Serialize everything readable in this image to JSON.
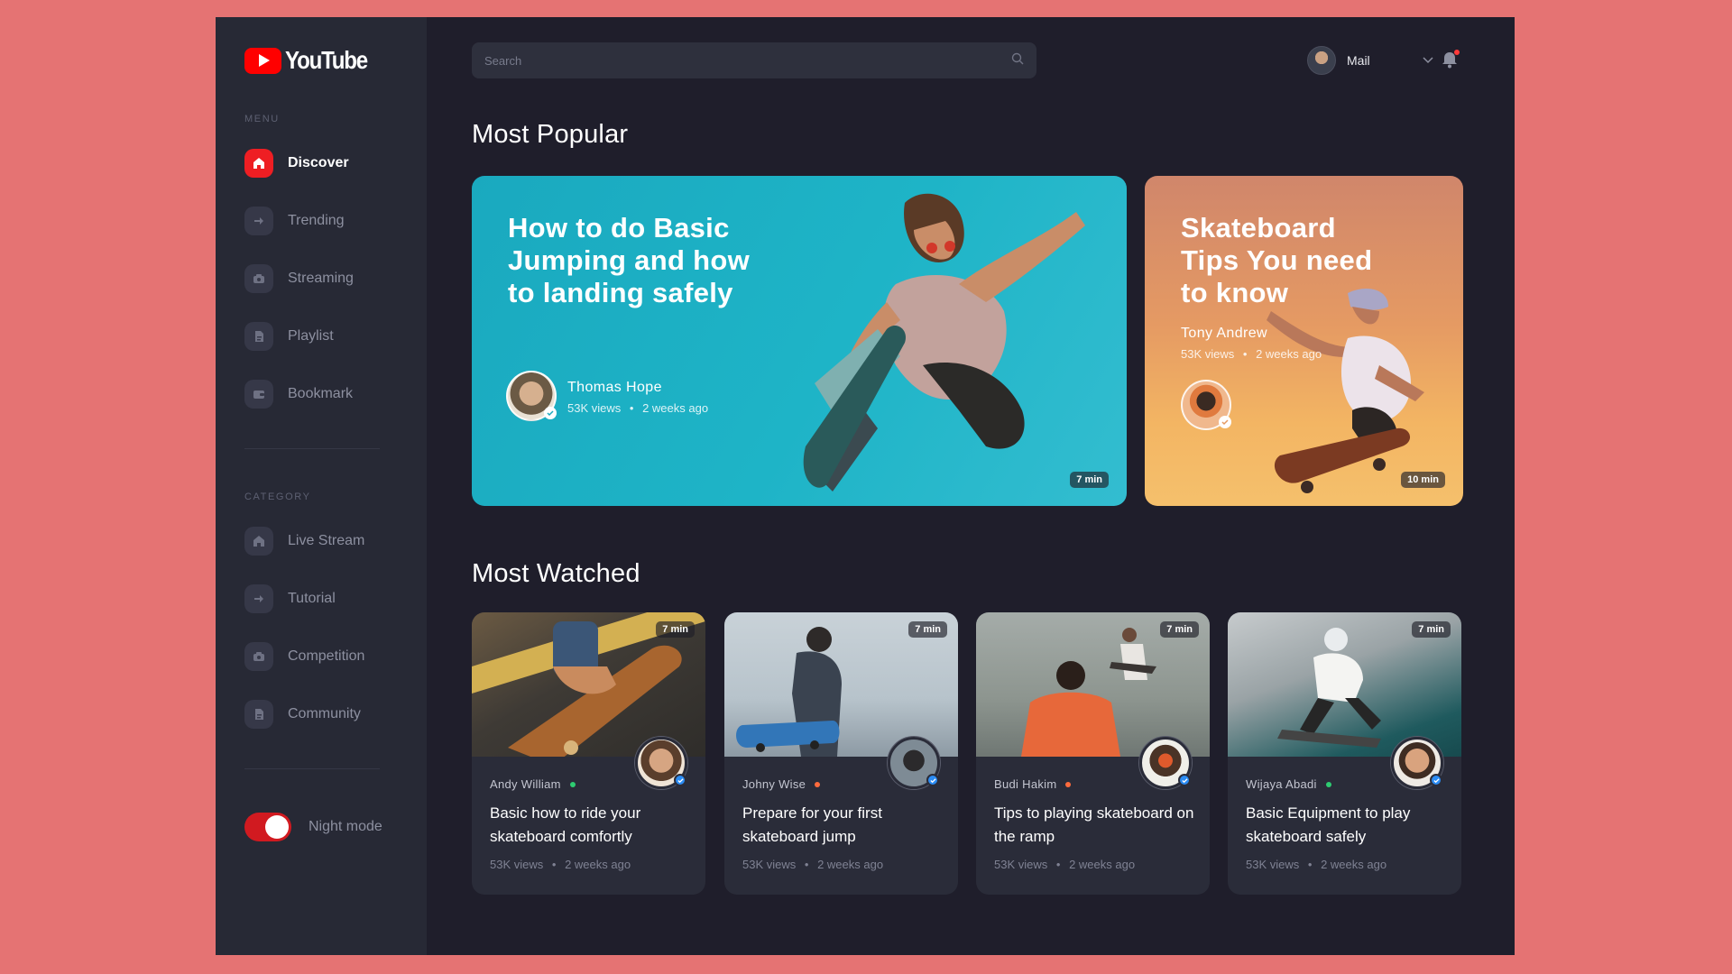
{
  "app": {
    "name": "YouTube"
  },
  "sidebar": {
    "menu_label": "MENU",
    "menu_items": [
      {
        "label": "Discover",
        "icon": "home-icon",
        "active": true
      },
      {
        "label": "Trending",
        "icon": "arrow-right-icon",
        "active": false
      },
      {
        "label": "Streaming",
        "icon": "camera-icon",
        "active": false
      },
      {
        "label": "Playlist",
        "icon": "document-icon",
        "active": false
      },
      {
        "label": "Bookmark",
        "icon": "wallet-icon",
        "active": false
      }
    ],
    "category_label": "CATEGORY",
    "category_items": [
      {
        "label": "Live Stream",
        "icon": "home-icon"
      },
      {
        "label": "Tutorial",
        "icon": "arrow-right-icon"
      },
      {
        "label": "Competition",
        "icon": "camera-icon"
      },
      {
        "label": "Community",
        "icon": "document-icon"
      }
    ],
    "night_mode": {
      "label": "Night mode",
      "on": true
    }
  },
  "header": {
    "search": {
      "placeholder": "Search",
      "value": ""
    },
    "user": {
      "name": "Mail"
    }
  },
  "most_popular": {
    "title": "Most Popular",
    "items": [
      {
        "title": "How to do Basic Jumping and how to landing safely",
        "author": "Thomas Hope",
        "views": "53K views",
        "age": "2 weeks ago",
        "duration": "7 min"
      },
      {
        "title": "Skateboard Tips You need to know",
        "author": "Tony Andrew",
        "views": "53K views",
        "age": "2 weeks ago",
        "duration": "10 min"
      }
    ]
  },
  "most_watched": {
    "title": "Most Watched",
    "items": [
      {
        "author": "Andy William",
        "status": "online",
        "title": "Basic how to ride your skateboard comfortly",
        "views": "53K views",
        "age": "2 weeks ago",
        "duration": "7 min"
      },
      {
        "author": "Johny Wise",
        "status": "away",
        "title": "Prepare for your first skateboard jump",
        "views": "53K views",
        "age": "2 weeks ago",
        "duration": "7 min"
      },
      {
        "author": "Budi Hakim",
        "status": "away",
        "title": "Tips to playing skateboard on the ramp",
        "views": "53K views",
        "age": "2 weeks ago",
        "duration": "7 min"
      },
      {
        "author": "Wijaya Abadi",
        "status": "online",
        "title": "Basic Equipment to play skateboard safely",
        "views": "53K views",
        "age": "2 weeks ago",
        "duration": "7 min"
      }
    ]
  },
  "colors": {
    "accent": "#ee1e23",
    "online": "#2ecc71",
    "away": "#ff6b3d",
    "background": "#1f1e2b",
    "sidebar": "#272935"
  },
  "separator": "•"
}
